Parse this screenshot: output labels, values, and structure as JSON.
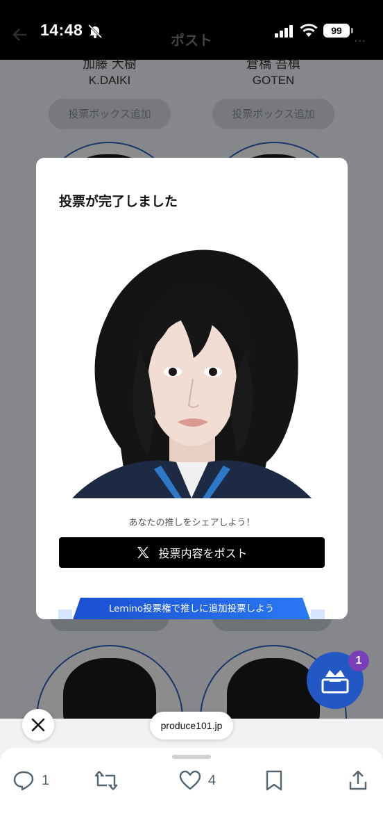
{
  "status_bar": {
    "time": "14:48",
    "battery": "99"
  },
  "nav": {
    "title": "ポスト",
    "more": "..."
  },
  "background": {
    "candidates": [
      {
        "name": "加藤 大樹",
        "roman": "K.DAIKI",
        "button": "投票ボックス追加"
      },
      {
        "name": "倉橋 吾槙",
        "roman": "GOTEN",
        "button": "投票ボックス追加"
      }
    ],
    "fab_badge": "1"
  },
  "modal": {
    "title": "投票が完了しました",
    "share_prompt": "あなたの推しをシェアしよう！",
    "post_button": "投票内容をポスト",
    "lemino_banner": "Lemino投票権で推しに追加投票しよう"
  },
  "browser": {
    "url": "produce101.jp",
    "actions": {
      "reply_count": "1",
      "like_count": "4"
    }
  }
}
